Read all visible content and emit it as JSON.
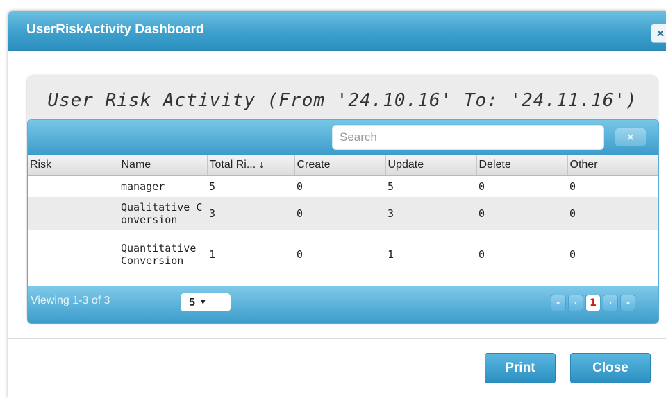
{
  "dialog": {
    "title": "UserRiskActivity Dashboard",
    "close_icon": "×"
  },
  "report": {
    "title": "User Risk Activity (From '24.10.16' To: '24.11.16')"
  },
  "grid": {
    "search_placeholder": "Search",
    "search_clear_icon": "×",
    "columns": [
      "Risk",
      "Name",
      "Total Ri... ↓",
      "Create",
      "Update",
      "Delete",
      "Other"
    ],
    "rows": [
      {
        "risk": "",
        "name": "manager",
        "total": "5",
        "create": "0",
        "update": "5",
        "delete": "0",
        "other": "0"
      },
      {
        "risk": "",
        "name": "Qualitative Conversion",
        "total": "3",
        "create": "0",
        "update": "3",
        "delete": "0",
        "other": "0"
      },
      {
        "risk": "",
        "name": "Quantitative Conversion",
        "total": "1",
        "create": "0",
        "update": "1",
        "delete": "0",
        "other": "0"
      }
    ],
    "footer": {
      "viewing": "Viewing 1-3 of 3",
      "page_size": "5",
      "page_size_arrow": "▼",
      "pager": {
        "first": "«",
        "prev": "‹",
        "current": "1",
        "next": "›",
        "last": "»"
      }
    }
  },
  "buttons": {
    "print": "Print",
    "close": "Close"
  },
  "colors": {
    "accent": "#3ea0cc",
    "current_page": "#cc1c1c"
  }
}
